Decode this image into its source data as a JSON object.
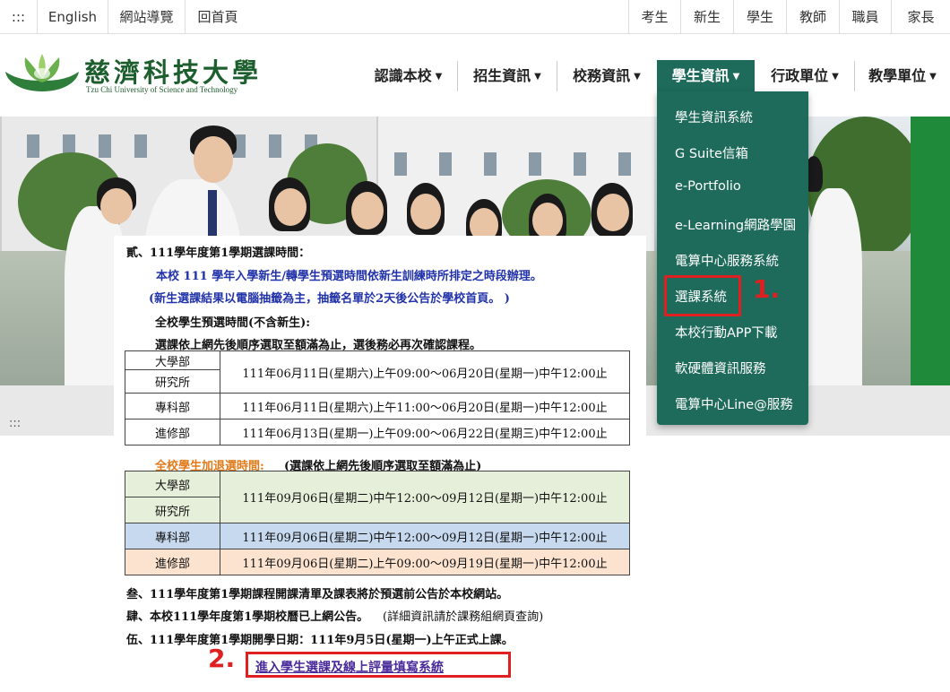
{
  "topbar": {
    "left": [
      ":::",
      "English",
      "網站導覽",
      "回首頁"
    ],
    "right": [
      "考生",
      "新生",
      "學生",
      "教師",
      "職員",
      "家長"
    ]
  },
  "logo": {
    "name": "慈濟科技大學",
    "en": "Tzu Chi University of Science and Technology"
  },
  "nav": [
    "認識本校",
    "招生資訊",
    "校務資訊",
    "學生資訊",
    "行政單位",
    "教學單位"
  ],
  "nav_active": "學生資訊",
  "dropdown": [
    "學生資訊系統",
    "G Suite信箱",
    "e-Portfolio",
    "e-Learning網路學園",
    "電算中心服務系統",
    "選課系統",
    "本校行動APP下載",
    "軟硬體資訊服務",
    "電算中心Line@服務"
  ],
  "markers": {
    "one": "1.",
    "two": "2."
  },
  "hero_dots": ":::",
  "notice": {
    "s2_title": "貳、111學年度第1學期選課時間：",
    "s2_line1": "本校 111 學年入學新生/轉學生預選時間依新生訓練時所排定之時段辦理。",
    "s2_line2": "(新生選課結果以電腦抽籤為主，抽籤名單於2天後公告於學校首頁。 )",
    "s2_line3": "全校學生預選時間(不含新生):",
    "s2_line4": "選課依上網先後順序選取至額滿為止，選後務必再次確認課程。",
    "table1": [
      {
        "unit": [
          "大學部",
          "研究所"
        ],
        "time": "111年06月11日(星期六)上午09:00～06月20日(星期一)中午12:00止"
      },
      {
        "unit": [
          "專科部"
        ],
        "time": "111年06月11日(星期六)上午11:00～06月20日(星期一)中午12:00止"
      },
      {
        "unit": [
          "進修部"
        ],
        "time": "111年06月13日(星期一)上午09:00～06月22日(星期三)中午12:00止"
      }
    ],
    "add_drop_label": "全校學生加退選時間:",
    "add_drop_note": "(選課依上網先後順序選取至額滿為止)",
    "table2": [
      {
        "unit": [
          "大學部",
          "研究所"
        ],
        "time": "111年09月06日(星期二)中午12:00～09月12日(星期一)中午12:00止"
      },
      {
        "unit": [
          "專科部"
        ],
        "time": "111年09月06日(星期二)中午12:00～09月12日(星期一)中午12:00止"
      },
      {
        "unit": [
          "進修部"
        ],
        "time": "111年09月06日(星期二)上午09:00～09月19日(星期一)中午12:00止"
      }
    ],
    "s3": "叁、111學年度第1學期課程開課清單及課表將於預選前公告於本校網站。",
    "s4": "肆、本校111學年度第1學期校曆已上網公告。",
    "s4_note": "(詳細資訊請於課務組網頁查詢)",
    "s5": "伍、111學年度第1學期開學日期：111年9月5日(星期一)上午正式上課。",
    "link": "進入學生選課及線上評量填寫系統"
  },
  "colors": {
    "nav_active": "#1e6a5b",
    "highlight": "#e02020",
    "row_green": "#e6efd9",
    "row_blue": "#c7d9ef",
    "row_peach": "#fbe3d0"
  }
}
